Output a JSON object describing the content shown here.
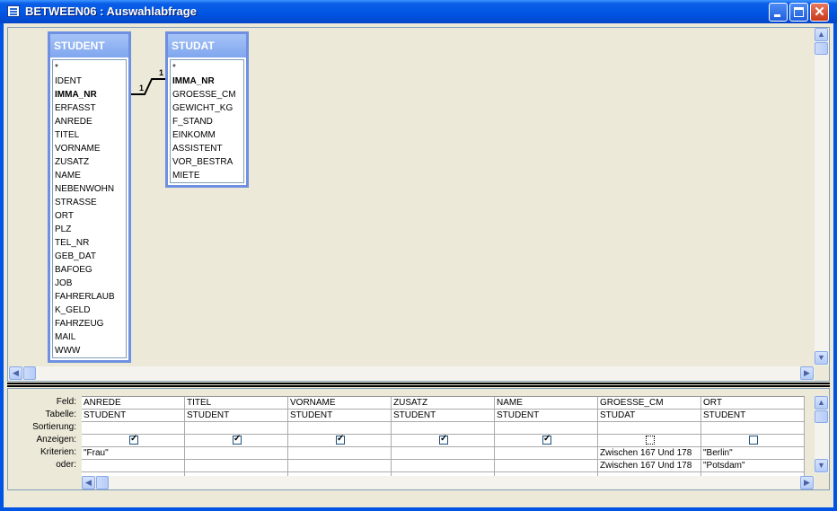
{
  "window": {
    "title": "BETWEEN06 : Auswahlabfrage"
  },
  "tables": [
    {
      "name": "STUDENT",
      "fields": [
        {
          "name": "*",
          "key": false
        },
        {
          "name": "IDENT",
          "key": false
        },
        {
          "name": "IMMA_NR",
          "key": true
        },
        {
          "name": "ERFASST",
          "key": false
        },
        {
          "name": "ANREDE",
          "key": false
        },
        {
          "name": "TITEL",
          "key": false
        },
        {
          "name": "VORNAME",
          "key": false
        },
        {
          "name": "ZUSATZ",
          "key": false
        },
        {
          "name": "NAME",
          "key": false
        },
        {
          "name": "NEBENWOHN",
          "key": false
        },
        {
          "name": "STRASSE",
          "key": false
        },
        {
          "name": "ORT",
          "key": false
        },
        {
          "name": "PLZ",
          "key": false
        },
        {
          "name": "TEL_NR",
          "key": false
        },
        {
          "name": "GEB_DAT",
          "key": false
        },
        {
          "name": "BAFOEG",
          "key": false
        },
        {
          "name": "JOB",
          "key": false
        },
        {
          "name": "FAHRERLAUB",
          "key": false
        },
        {
          "name": "K_GELD",
          "key": false
        },
        {
          "name": "FAHRZEUG",
          "key": false
        },
        {
          "name": "MAIL",
          "key": false
        },
        {
          "name": "WWW",
          "key": false
        }
      ]
    },
    {
      "name": "STUDAT",
      "fields": [
        {
          "name": "*",
          "key": false
        },
        {
          "name": "IMMA_NR",
          "key": true
        },
        {
          "name": "GROESSE_CM",
          "key": false
        },
        {
          "name": "GEWICHT_KG",
          "key": false
        },
        {
          "name": "F_STAND",
          "key": false
        },
        {
          "name": "EINKOMM",
          "key": false
        },
        {
          "name": "ASSISTENT",
          "key": false
        },
        {
          "name": "VOR_BESTRA",
          "key": false
        },
        {
          "name": "MIETE",
          "key": false
        }
      ]
    }
  ],
  "relationship": {
    "left_label": "1",
    "right_label": "1"
  },
  "grid": {
    "row_labels": [
      "Feld:",
      "Tabelle:",
      "Sortierung:",
      "Anzeigen:",
      "Kriterien:",
      "oder:"
    ],
    "columns": [
      {
        "field": "ANREDE",
        "table": "STUDENT",
        "sort": "",
        "show": true,
        "criteria": "\"Frau\"",
        "or": ""
      },
      {
        "field": "TITEL",
        "table": "STUDENT",
        "sort": "",
        "show": true,
        "criteria": "",
        "or": ""
      },
      {
        "field": "VORNAME",
        "table": "STUDENT",
        "sort": "",
        "show": true,
        "criteria": "",
        "or": ""
      },
      {
        "field": "ZUSATZ",
        "table": "STUDENT",
        "sort": "",
        "show": true,
        "criteria": "",
        "or": ""
      },
      {
        "field": "NAME",
        "table": "STUDENT",
        "sort": "",
        "show": true,
        "criteria": "",
        "or": ""
      },
      {
        "field": "GROESSE_CM",
        "table": "STUDAT",
        "sort": "",
        "show": false,
        "criteria": "Zwischen 167 Und 178",
        "or": "Zwischen 167 Und 178"
      },
      {
        "field": "ORT",
        "table": "STUDENT",
        "sort": "",
        "show": false,
        "criteria": "\"Berlin\"",
        "or": "\"Potsdam\""
      }
    ]
  }
}
